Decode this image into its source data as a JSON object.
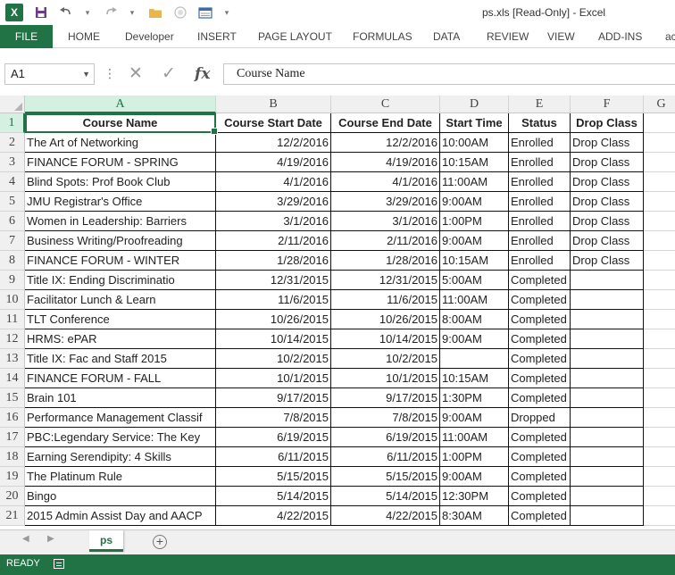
{
  "window": {
    "title": "ps.xls  [Read-Only] - Excel"
  },
  "quick_access": {
    "icons": [
      "excel-logo-icon",
      "save-icon",
      "undo-icon",
      "redo-icon",
      "open-folder-icon",
      "touch-mode-icon",
      "print-preview-icon",
      "customize-qat-icon"
    ],
    "excel_badge": "X"
  },
  "ribbon": {
    "tabs": [
      "FILE",
      "HOME",
      "Developer",
      "INSERT",
      "PAGE LAYOUT",
      "FORMULAS",
      "DATA",
      "REVIEW",
      "VIEW",
      "ADD-INS",
      "ac"
    ]
  },
  "formula_bar": {
    "name_box": "A1",
    "content": "Course Name",
    "cancel": "✕",
    "enter": "✓",
    "fx": "fx"
  },
  "columns": [
    "A",
    "B",
    "C",
    "D",
    "E",
    "F",
    "G"
  ],
  "selected_column": "A",
  "rows": [
    [
      "Course Name",
      "Course Start Date",
      "Course End Date",
      "Start Time",
      "Status",
      "Drop Class"
    ],
    [
      "The Art of Networking",
      "12/2/2016",
      "12/2/2016",
      "10:00AM",
      "Enrolled",
      "Drop Class"
    ],
    [
      "FINANCE FORUM - SPRING",
      "4/19/2016",
      "4/19/2016",
      "10:15AM",
      "Enrolled",
      "Drop Class"
    ],
    [
      "Blind Spots: Prof Book Club",
      "4/1/2016",
      "4/1/2016",
      "11:00AM",
      "Enrolled",
      "Drop Class"
    ],
    [
      "JMU Registrar's Office",
      "3/29/2016",
      "3/29/2016",
      "9:00AM",
      "Enrolled",
      "Drop Class"
    ],
    [
      "Women in Leadership: Barriers",
      "3/1/2016",
      "3/1/2016",
      "1:00PM",
      "Enrolled",
      "Drop Class"
    ],
    [
      "Business Writing/Proofreading",
      "2/11/2016",
      "2/11/2016",
      "9:00AM",
      "Enrolled",
      "Drop Class"
    ],
    [
      "FINANCE FORUM - WINTER",
      "1/28/2016",
      "1/28/2016",
      "10:15AM",
      "Enrolled",
      "Drop Class"
    ],
    [
      "Title IX: Ending Discriminatio",
      "12/31/2015",
      "12/31/2015",
      "5:00AM",
      "Completed",
      ""
    ],
    [
      "Facilitator Lunch & Learn",
      "11/6/2015",
      "11/6/2015",
      "11:00AM",
      "Completed",
      ""
    ],
    [
      "TLT Conference",
      "10/26/2015",
      "10/26/2015",
      "8:00AM",
      "Completed",
      ""
    ],
    [
      "HRMS: ePAR",
      "10/14/2015",
      "10/14/2015",
      "9:00AM",
      "Completed",
      ""
    ],
    [
      "Title IX: Fac and Staff 2015",
      "10/2/2015",
      "10/2/2015",
      "",
      "Completed",
      ""
    ],
    [
      "FINANCE FORUM - FALL",
      "10/1/2015",
      "10/1/2015",
      "10:15AM",
      "Completed",
      ""
    ],
    [
      "Brain 101",
      "9/17/2015",
      "9/17/2015",
      "1:30PM",
      "Completed",
      ""
    ],
    [
      "Performance Management Classif",
      "7/8/2015",
      "7/8/2015",
      "9:00AM",
      "Dropped",
      ""
    ],
    [
      "PBC:Legendary Service: The Key",
      "6/19/2015",
      "6/19/2015",
      "11:00AM",
      "Completed",
      ""
    ],
    [
      "Earning Serendipity: 4 Skills",
      "6/11/2015",
      "6/11/2015",
      "1:00PM",
      "Completed",
      ""
    ],
    [
      "The Platinum Rule",
      "5/15/2015",
      "5/15/2015",
      "9:00AM",
      "Completed",
      ""
    ],
    [
      "Bingo",
      "5/14/2015",
      "5/14/2015",
      "12:30PM",
      "Completed",
      ""
    ],
    [
      "2015 Admin Assist Day and AACP",
      "4/22/2015",
      "4/22/2015",
      "8:30AM",
      "Completed",
      ""
    ]
  ],
  "sheets": [
    {
      "name": "ps",
      "active": true
    }
  ],
  "add_sheet": "+",
  "status": {
    "text": "READY"
  },
  "colors": {
    "accent": "#217346",
    "selected_header": "#d3f0e0"
  }
}
